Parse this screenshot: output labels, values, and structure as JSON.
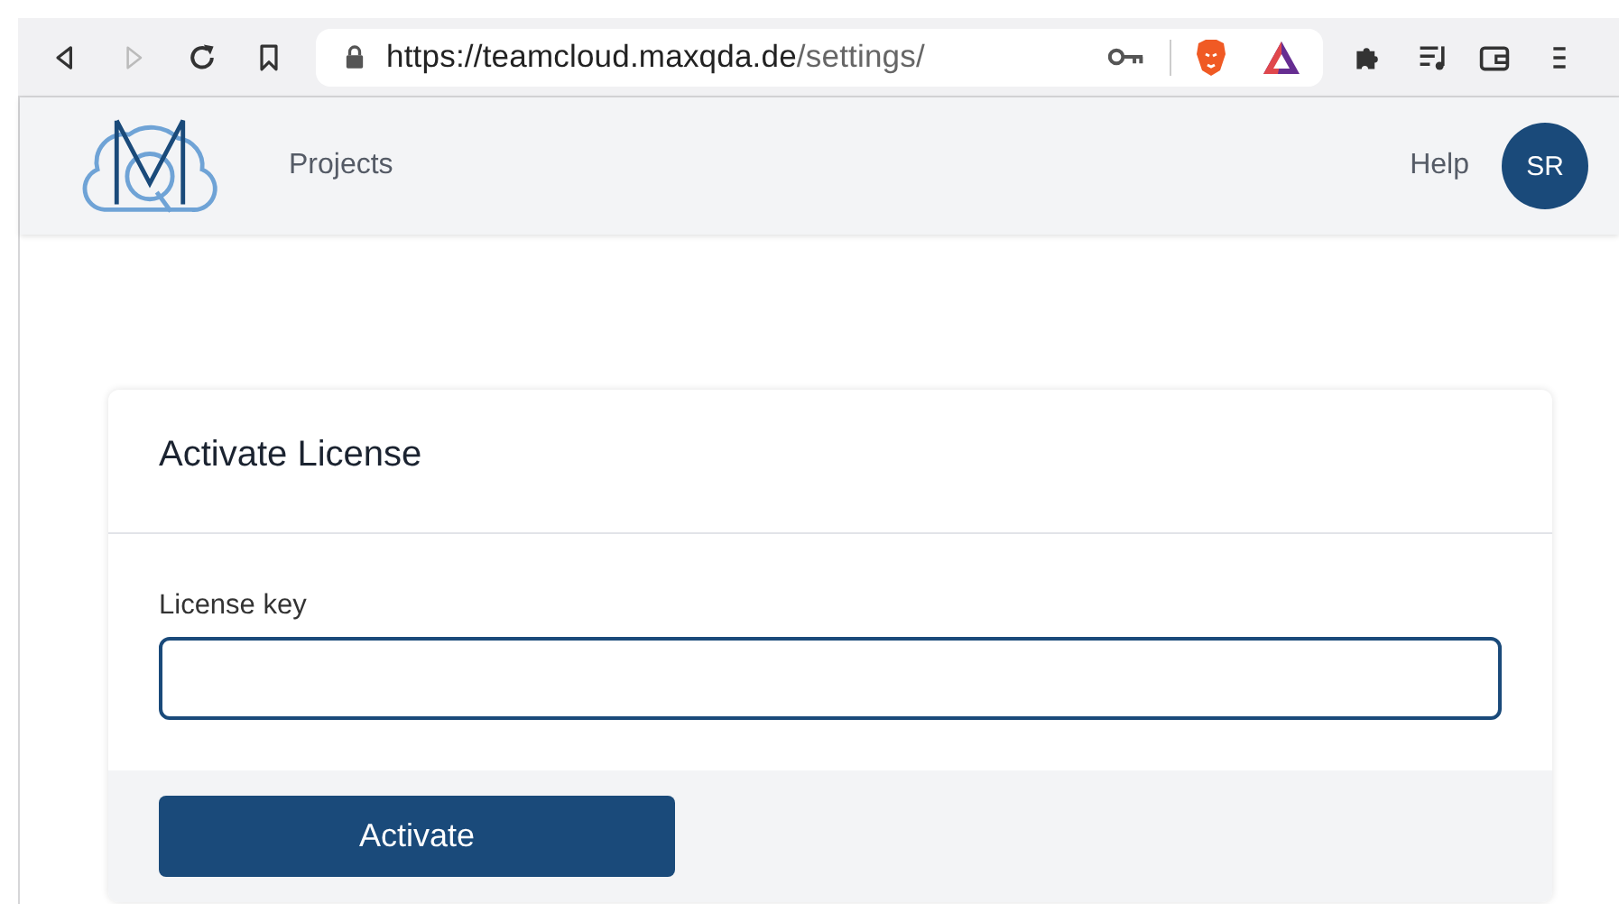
{
  "browser": {
    "url_host": "https://teamcloud.maxqda.de",
    "url_path": "/settings/",
    "forward_disabled": true
  },
  "header": {
    "nav": [
      {
        "label": "Projects"
      }
    ],
    "help": "Help",
    "avatar": "SR"
  },
  "card": {
    "title": "Activate License",
    "field_label": "License key",
    "field": {
      "focused": true
    },
    "button": "Activate"
  }
}
